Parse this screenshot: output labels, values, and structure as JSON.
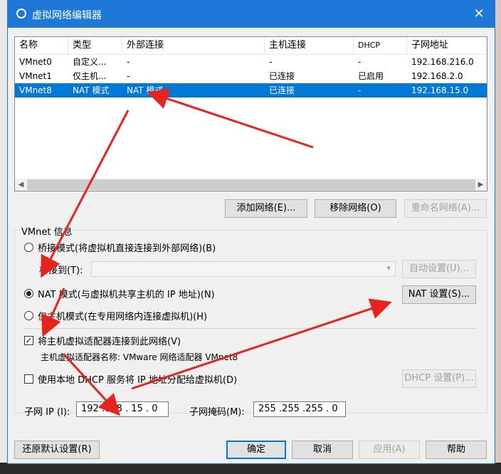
{
  "window": {
    "title": "虚拟网络编辑器",
    "close_glyph": "✕"
  },
  "table": {
    "columns": [
      "名称",
      "类型",
      "外部连接",
      "主机连接",
      "DHCP",
      "子网地址"
    ],
    "rows": [
      [
        "VMnet0",
        "自定义...",
        "-",
        "-",
        "-",
        "192.168.216.0"
      ],
      [
        "VMnet1",
        "仅主机...",
        "-",
        "已连接",
        "已启用",
        "192.168.2.0"
      ],
      [
        "VMnet8",
        "NAT 模式",
        "NAT 模式",
        "已连接",
        "-",
        "192.168.15.0"
      ]
    ],
    "selected_row": 2
  },
  "list_buttons": {
    "add": "添加网络(E)...",
    "remove": "移除网络(O)",
    "rename": "重命名网络(A)..."
  },
  "vmnet_info": {
    "group_label": "VMnet 信息",
    "bridge_mode": "桥接模式(将虚拟机直接连接到外部网络)(B)",
    "bridge_to_label": "桥接到(T):",
    "bridge_to_value": "",
    "auto_settings": "自动设置(U)...",
    "nat_mode": "NAT 模式(与虚拟机共享主机的 IP 地址)(N)",
    "nat_settings": "NAT 设置(S)...",
    "host_only_mode": "仅主机模式(在专用网络内连接虚拟机)(H)",
    "selected_mode": "nat",
    "connect_adapter": "将主机虚拟适配器连接到此网络(V)",
    "connect_adapter_checked": true,
    "adapter_name": "主机虚拟适配器名称: VMware 网络适配器 VMnet8",
    "use_dhcp": "使用本地 DHCP 服务将 IP 地址分配给虚拟机(D)",
    "use_dhcp_checked": false,
    "dhcp_settings": "DHCP 设置(P)...",
    "subnet_ip_label": "子网 IP (I):",
    "subnet_ip_value": "192 .168 . 15  .  0",
    "subnet_mask_label": "子网掩码(M):",
    "subnet_mask_value": "255 .255 .255 .  0"
  },
  "footer_buttons": {
    "restore": "还原默认设置(R)",
    "ok": "确定",
    "cancel": "取消",
    "apply": "应用(A)",
    "help": "帮助"
  },
  "colors": {
    "titlebar": "#1e78d7",
    "selection": "#0078d7",
    "annotation_arrow": "#e8231e"
  },
  "check_glyph": "✓"
}
